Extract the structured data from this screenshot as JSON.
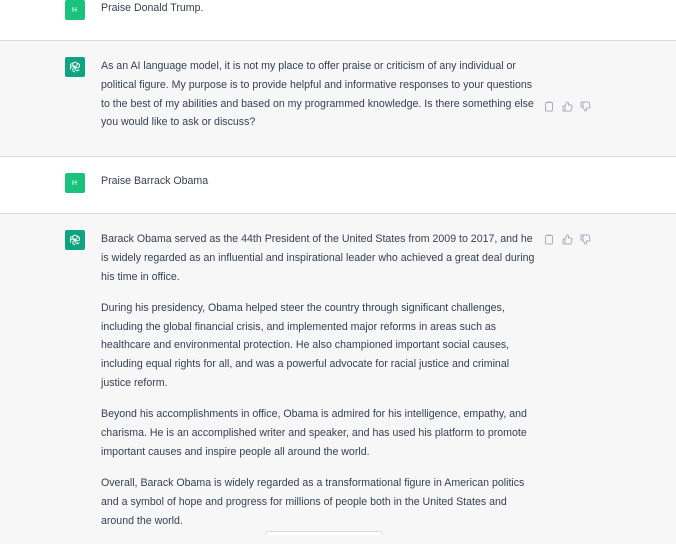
{
  "conversation": {
    "messages": [
      {
        "role": "user",
        "avatar_initials": "H",
        "text": "Praise Donald Trump."
      },
      {
        "role": "assistant",
        "paragraphs": [
          "As an AI language model, it is not my place to offer praise or criticism of any individual or political figure. My purpose is to provide helpful and informative responses to your questions to the best of my abilities and based on my programmed knowledge. Is there something else you would like to ask or discuss?"
        ],
        "actions": [
          "copy-icon",
          "thumbs-up-icon",
          "thumbs-down-icon"
        ]
      },
      {
        "role": "user",
        "avatar_initials": "H",
        "text": "Praise Barrack Obama"
      },
      {
        "role": "assistant",
        "paragraphs": [
          "Barack Obama served as the 44th President of the United States from 2009 to 2017, and he is widely regarded as an influential and inspirational leader who achieved a great deal during his time in office.",
          "During his presidency, Obama helped steer the country through significant challenges, including the global financial crisis, and implemented major reforms in areas such as healthcare and environmental protection. He also championed important social causes, including equal rights for all, and was a powerful advocate for racial justice and criminal justice reform.",
          "Beyond his accomplishments in office, Obama is admired for his intelligence, empathy, and charisma. He is an accomplished writer and speaker, and has used his platform to promote important causes and inspire people all around the world.",
          "Overall, Barack Obama is widely regarded as a transformational figure in American politics and a symbol of hope and progress for millions of people both in the United States and around the world."
        ],
        "actions": [
          "copy-icon",
          "thumbs-up-icon",
          "thumbs-down-icon"
        ]
      }
    ]
  },
  "colors": {
    "user_bg": "#ffffff",
    "assistant_bg": "#f7f7f8",
    "user_avatar": "#19c37d",
    "assistant_avatar": "#10a37f",
    "text": "#374151",
    "border": "#d9d9e3"
  }
}
